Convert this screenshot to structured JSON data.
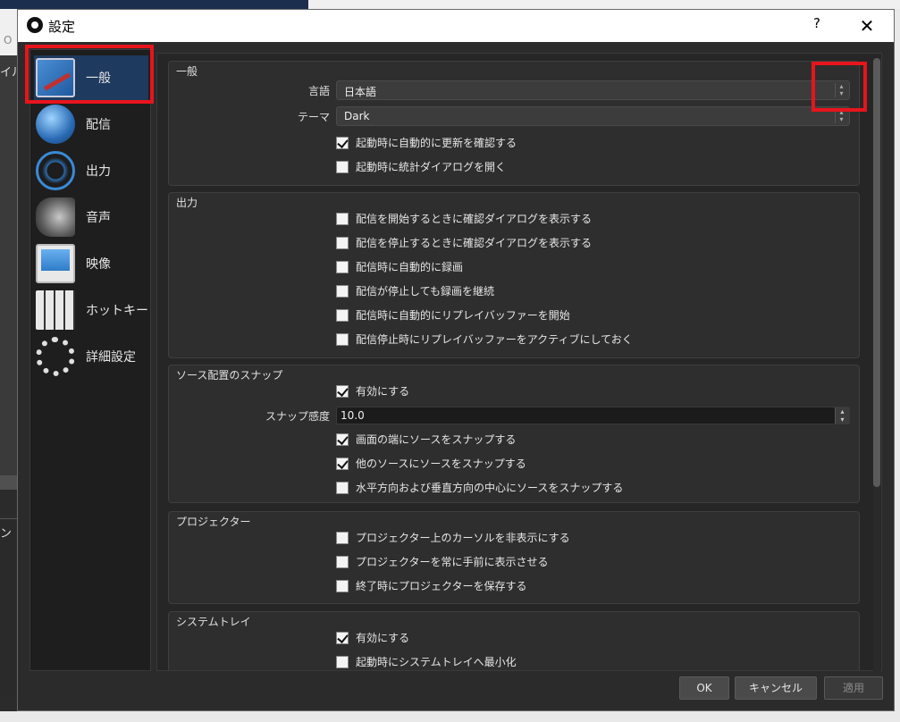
{
  "background": {
    "left_texts": [
      "O",
      "イル",
      "ン"
    ]
  },
  "dialog": {
    "title": "設定",
    "help_label": "?",
    "close_label": "✕"
  },
  "sidebar": {
    "items": [
      {
        "label": "一般",
        "icon": "general-icon",
        "active": true
      },
      {
        "label": "配信",
        "icon": "stream-icon",
        "active": false
      },
      {
        "label": "出力",
        "icon": "output-icon",
        "active": false
      },
      {
        "label": "音声",
        "icon": "audio-icon",
        "active": false
      },
      {
        "label": "映像",
        "icon": "video-icon",
        "active": false
      },
      {
        "label": "ホットキー",
        "icon": "hotkey-icon",
        "active": false
      },
      {
        "label": "詳細設定",
        "icon": "advanced-settings-icon",
        "active": false
      }
    ]
  },
  "general": {
    "title": "一般",
    "language_label": "言語",
    "language_value": "日本語",
    "theme_label": "テーマ",
    "theme_value": "Dark",
    "check_updates": {
      "label": "起動時に自動的に更新を確認する",
      "checked": true
    },
    "open_stats": {
      "label": "起動時に統計ダイアログを開く",
      "checked": false
    }
  },
  "output": {
    "title": "出力",
    "checks": [
      {
        "label": "配信を開始するときに確認ダイアログを表示する",
        "checked": false
      },
      {
        "label": "配信を停止するときに確認ダイアログを表示する",
        "checked": false
      },
      {
        "label": "配信時に自動的に録画",
        "checked": false
      },
      {
        "label": "配信が停止しても録画を継続",
        "checked": false
      },
      {
        "label": "配信時に自動的にリプレイバッファーを開始",
        "checked": false
      },
      {
        "label": "配信停止時にリプレイバッファーをアクティブにしておく",
        "checked": false
      }
    ]
  },
  "snapping": {
    "title": "ソース配置のスナップ",
    "enable": {
      "label": "有効にする",
      "checked": true
    },
    "sensitivity_label": "スナップ感度",
    "sensitivity_value": "10.0",
    "checks": [
      {
        "label": "画面の端にソースをスナップする",
        "checked": true
      },
      {
        "label": "他のソースにソースをスナップする",
        "checked": true
      },
      {
        "label": "水平方向および垂直方向の中心にソースをスナップする",
        "checked": false
      }
    ]
  },
  "projectors": {
    "title": "プロジェクター",
    "checks": [
      {
        "label": "プロジェクター上のカーソルを非表示にする",
        "checked": false
      },
      {
        "label": "プロジェクターを常に手前に表示させる",
        "checked": false
      },
      {
        "label": "終了時にプロジェクターを保存する",
        "checked": false
      }
    ]
  },
  "system_tray": {
    "title": "システムトレイ",
    "checks": [
      {
        "label": "有効にする",
        "checked": true
      },
      {
        "label": "起動時にシステムトレイへ最小化",
        "checked": false
      }
    ]
  },
  "buttons": {
    "ok": "OK",
    "cancel": "キャンセル",
    "apply": "適用"
  },
  "colors": {
    "highlight": "#e8141c",
    "active_nav": "#1e3a5e",
    "dialog_bg": "#2b2b2b"
  }
}
